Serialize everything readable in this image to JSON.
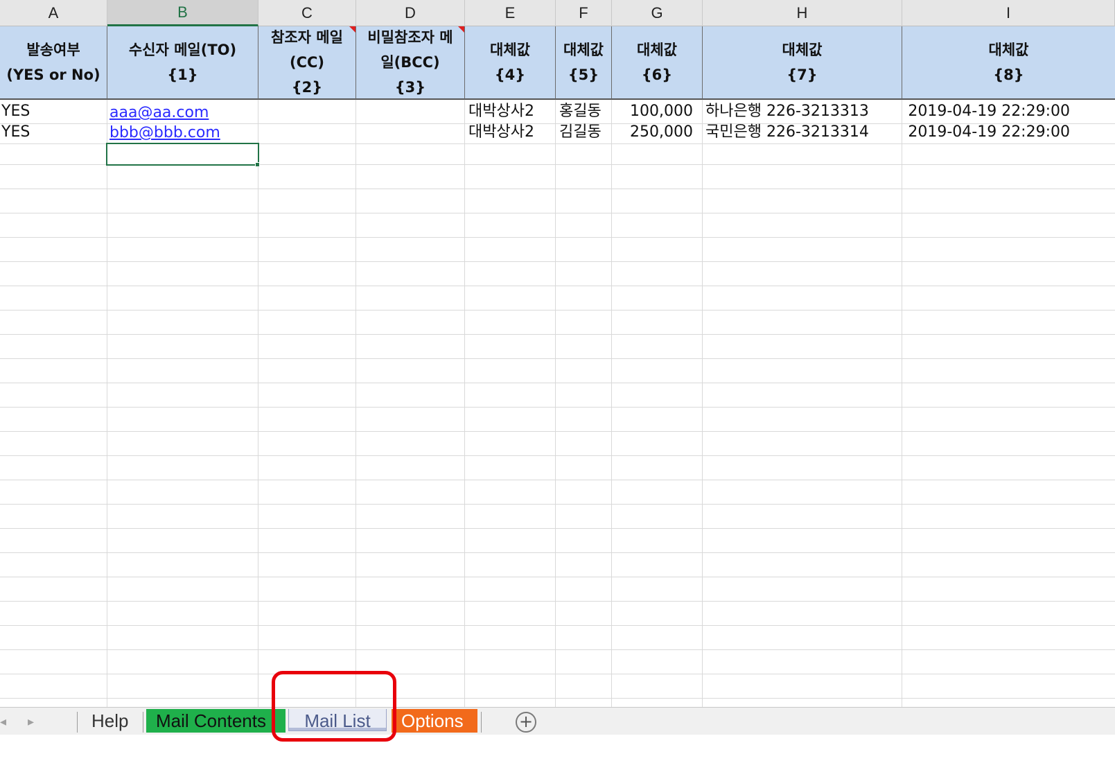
{
  "columns": [
    "A",
    "B",
    "C",
    "D",
    "E",
    "F",
    "G",
    "H",
    "I"
  ],
  "selected_column": "B",
  "header_row": [
    {
      "line1": "발송여부",
      "line2": "(YES or No)",
      "line3": ""
    },
    {
      "line1": "수신자 메일(TO)",
      "line2": "{1}",
      "line3": ""
    },
    {
      "line1": "참조자 메일",
      "line2": "(CC)",
      "line3": "{2}"
    },
    {
      "line1": "비밀참조자 메",
      "line2": "일(BCC)",
      "line3": "{3}"
    },
    {
      "line1": "대체값",
      "line2": "{4}",
      "line3": ""
    },
    {
      "line1": "대체값",
      "line2": "{5}",
      "line3": ""
    },
    {
      "line1": "대체값",
      "line2": "{6}",
      "line3": ""
    },
    {
      "line1": "대체값",
      "line2": "{7}",
      "line3": ""
    },
    {
      "line1": "대체값",
      "line2": "{8}",
      "line3": ""
    }
  ],
  "rows": [
    {
      "send": "YES",
      "to": "aaa@aa.com",
      "cc": "",
      "bcc": "",
      "v4": "대박상사2",
      "v5": "홍길동",
      "v6": "100,000",
      "v7": "하나은행 226-3213313",
      "v8": "2019-04-19 22:29:00"
    },
    {
      "send": "YES",
      "to": "bbb@bbb.com",
      "cc": "",
      "bcc": "",
      "v4": "대박상사2",
      "v5": "김길동",
      "v6": "250,000",
      "v7": "국민은행 226-3213314",
      "v8": "2019-04-19 22:29:00"
    }
  ],
  "sheet_tabs": {
    "help": "Help",
    "mail_contents": "Mail Contents",
    "mail_list": "Mail List",
    "options": "Options",
    "add_icon": "plus-circle-icon"
  },
  "colors": {
    "header_fill": "#c5d9f1",
    "tab_mail_contents": "#1fb04b",
    "tab_options": "#f26a1b",
    "highlight": "#e8000b",
    "active_cell": "#217346"
  }
}
